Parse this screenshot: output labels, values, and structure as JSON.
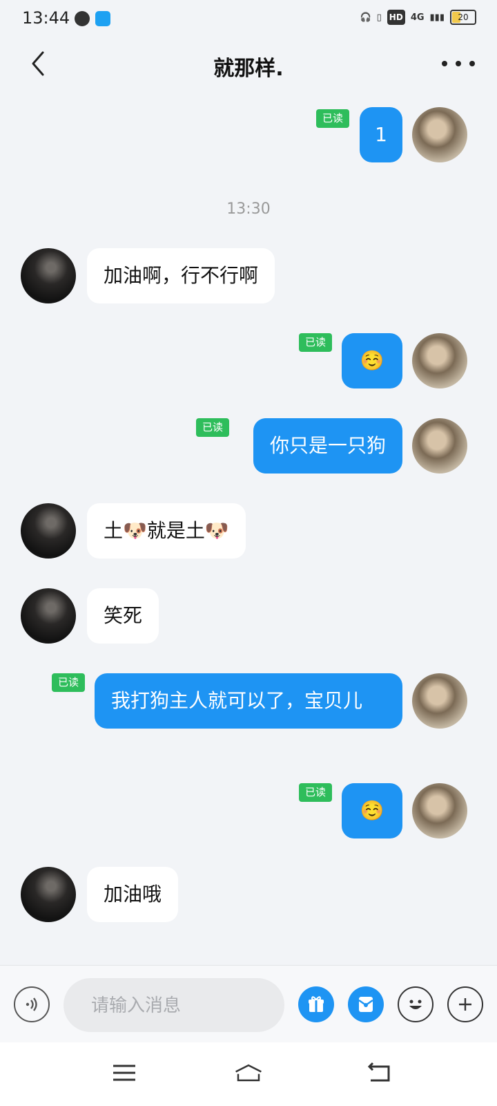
{
  "status_bar": {
    "time": "13:44",
    "network": "4G",
    "battery": "20",
    "hd": "HD"
  },
  "header": {
    "title": "就那样."
  },
  "messages": [
    {
      "side": "self",
      "text": "1",
      "read": "已读"
    },
    {
      "type": "timestamp",
      "text": "13:30"
    },
    {
      "side": "peer",
      "text": "加油啊，行不行啊"
    },
    {
      "side": "self",
      "text": "☺️",
      "read": "已读"
    },
    {
      "side": "self",
      "text": "你只是一只狗",
      "read": "已读"
    },
    {
      "side": "peer",
      "text": "土🐶就是土🐶"
    },
    {
      "side": "peer",
      "text": "笑死"
    },
    {
      "side": "self",
      "text": "我打狗主人就可以了，宝贝儿",
      "read": "已读"
    },
    {
      "side": "self",
      "text": "☺️",
      "read": "已读"
    },
    {
      "side": "peer",
      "text": "加油哦"
    }
  ],
  "input": {
    "placeholder": "请输入消息"
  },
  "icons": {
    "back": "back-arrow-icon",
    "more": "more-dots-icon",
    "voice": "voice-icon",
    "gift": "gift-icon",
    "redpacket": "red-packet-icon",
    "emoji": "emoji-icon",
    "plus": "plus-icon"
  },
  "colors": {
    "self_bubble": "#1e94f3",
    "read_badge": "#2ebd5b",
    "background": "#f2f4f7"
  }
}
